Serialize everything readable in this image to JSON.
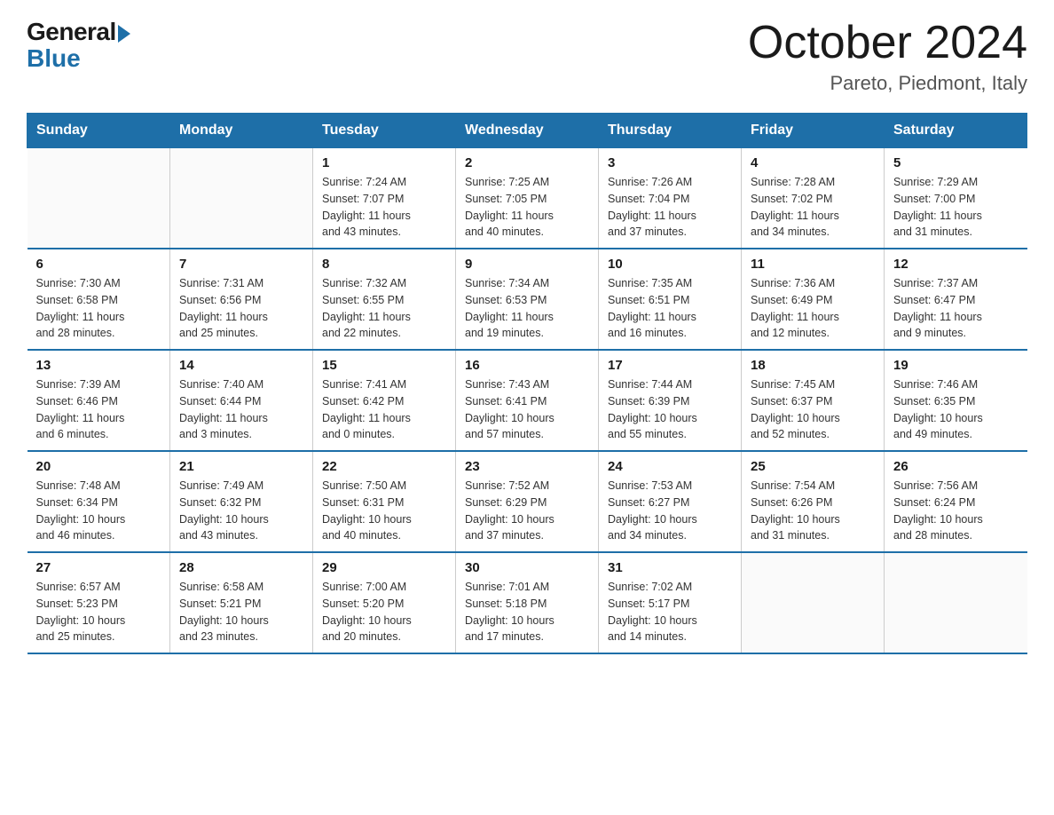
{
  "logo": {
    "general": "General",
    "blue": "Blue"
  },
  "title": {
    "month_year": "October 2024",
    "location": "Pareto, Piedmont, Italy"
  },
  "days_header": [
    "Sunday",
    "Monday",
    "Tuesday",
    "Wednesday",
    "Thursday",
    "Friday",
    "Saturday"
  ],
  "weeks": [
    [
      {
        "day": "",
        "info": ""
      },
      {
        "day": "",
        "info": ""
      },
      {
        "day": "1",
        "info": "Sunrise: 7:24 AM\nSunset: 7:07 PM\nDaylight: 11 hours\nand 43 minutes."
      },
      {
        "day": "2",
        "info": "Sunrise: 7:25 AM\nSunset: 7:05 PM\nDaylight: 11 hours\nand 40 minutes."
      },
      {
        "day": "3",
        "info": "Sunrise: 7:26 AM\nSunset: 7:04 PM\nDaylight: 11 hours\nand 37 minutes."
      },
      {
        "day": "4",
        "info": "Sunrise: 7:28 AM\nSunset: 7:02 PM\nDaylight: 11 hours\nand 34 minutes."
      },
      {
        "day": "5",
        "info": "Sunrise: 7:29 AM\nSunset: 7:00 PM\nDaylight: 11 hours\nand 31 minutes."
      }
    ],
    [
      {
        "day": "6",
        "info": "Sunrise: 7:30 AM\nSunset: 6:58 PM\nDaylight: 11 hours\nand 28 minutes."
      },
      {
        "day": "7",
        "info": "Sunrise: 7:31 AM\nSunset: 6:56 PM\nDaylight: 11 hours\nand 25 minutes."
      },
      {
        "day": "8",
        "info": "Sunrise: 7:32 AM\nSunset: 6:55 PM\nDaylight: 11 hours\nand 22 minutes."
      },
      {
        "day": "9",
        "info": "Sunrise: 7:34 AM\nSunset: 6:53 PM\nDaylight: 11 hours\nand 19 minutes."
      },
      {
        "day": "10",
        "info": "Sunrise: 7:35 AM\nSunset: 6:51 PM\nDaylight: 11 hours\nand 16 minutes."
      },
      {
        "day": "11",
        "info": "Sunrise: 7:36 AM\nSunset: 6:49 PM\nDaylight: 11 hours\nand 12 minutes."
      },
      {
        "day": "12",
        "info": "Sunrise: 7:37 AM\nSunset: 6:47 PM\nDaylight: 11 hours\nand 9 minutes."
      }
    ],
    [
      {
        "day": "13",
        "info": "Sunrise: 7:39 AM\nSunset: 6:46 PM\nDaylight: 11 hours\nand 6 minutes."
      },
      {
        "day": "14",
        "info": "Sunrise: 7:40 AM\nSunset: 6:44 PM\nDaylight: 11 hours\nand 3 minutes."
      },
      {
        "day": "15",
        "info": "Sunrise: 7:41 AM\nSunset: 6:42 PM\nDaylight: 11 hours\nand 0 minutes."
      },
      {
        "day": "16",
        "info": "Sunrise: 7:43 AM\nSunset: 6:41 PM\nDaylight: 10 hours\nand 57 minutes."
      },
      {
        "day": "17",
        "info": "Sunrise: 7:44 AM\nSunset: 6:39 PM\nDaylight: 10 hours\nand 55 minutes."
      },
      {
        "day": "18",
        "info": "Sunrise: 7:45 AM\nSunset: 6:37 PM\nDaylight: 10 hours\nand 52 minutes."
      },
      {
        "day": "19",
        "info": "Sunrise: 7:46 AM\nSunset: 6:35 PM\nDaylight: 10 hours\nand 49 minutes."
      }
    ],
    [
      {
        "day": "20",
        "info": "Sunrise: 7:48 AM\nSunset: 6:34 PM\nDaylight: 10 hours\nand 46 minutes."
      },
      {
        "day": "21",
        "info": "Sunrise: 7:49 AM\nSunset: 6:32 PM\nDaylight: 10 hours\nand 43 minutes."
      },
      {
        "day": "22",
        "info": "Sunrise: 7:50 AM\nSunset: 6:31 PM\nDaylight: 10 hours\nand 40 minutes."
      },
      {
        "day": "23",
        "info": "Sunrise: 7:52 AM\nSunset: 6:29 PM\nDaylight: 10 hours\nand 37 minutes."
      },
      {
        "day": "24",
        "info": "Sunrise: 7:53 AM\nSunset: 6:27 PM\nDaylight: 10 hours\nand 34 minutes."
      },
      {
        "day": "25",
        "info": "Sunrise: 7:54 AM\nSunset: 6:26 PM\nDaylight: 10 hours\nand 31 minutes."
      },
      {
        "day": "26",
        "info": "Sunrise: 7:56 AM\nSunset: 6:24 PM\nDaylight: 10 hours\nand 28 minutes."
      }
    ],
    [
      {
        "day": "27",
        "info": "Sunrise: 6:57 AM\nSunset: 5:23 PM\nDaylight: 10 hours\nand 25 minutes."
      },
      {
        "day": "28",
        "info": "Sunrise: 6:58 AM\nSunset: 5:21 PM\nDaylight: 10 hours\nand 23 minutes."
      },
      {
        "day": "29",
        "info": "Sunrise: 7:00 AM\nSunset: 5:20 PM\nDaylight: 10 hours\nand 20 minutes."
      },
      {
        "day": "30",
        "info": "Sunrise: 7:01 AM\nSunset: 5:18 PM\nDaylight: 10 hours\nand 17 minutes."
      },
      {
        "day": "31",
        "info": "Sunrise: 7:02 AM\nSunset: 5:17 PM\nDaylight: 10 hours\nand 14 minutes."
      },
      {
        "day": "",
        "info": ""
      },
      {
        "day": "",
        "info": ""
      }
    ]
  ]
}
